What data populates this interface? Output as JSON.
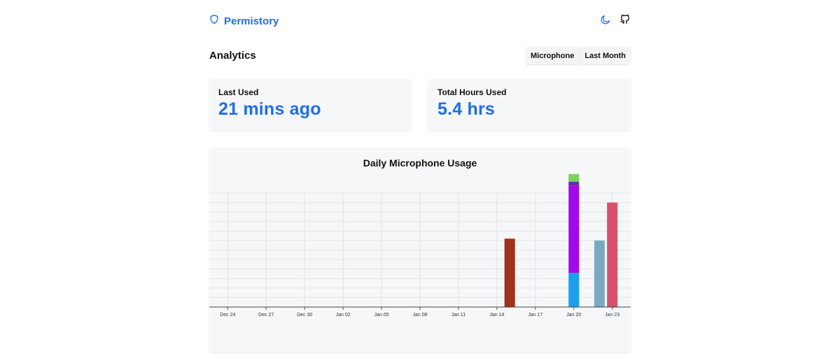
{
  "header": {
    "brand": "Permistory",
    "brand_icon": "shield-icon",
    "theme_icon": "moon-icon",
    "repo_icon": "github-icon",
    "accent": "#1f6fe5"
  },
  "analytics": {
    "title": "Analytics",
    "metric_button": "Microphone",
    "range_button": "Last Month"
  },
  "cards": {
    "last_used": {
      "label": "Last Used",
      "value": "21 mins ago"
    },
    "total_hours": {
      "label": "Total Hours Used",
      "value": "5.4 hrs"
    }
  },
  "chart_data": {
    "type": "bar",
    "stacked": true,
    "title": "Daily Microphone Usage",
    "xlabel": "",
    "ylabel": "",
    "grid": true,
    "x_tick_labels": [
      "Dec 24",
      "Dec 27",
      "Dec 30",
      "Jan 02",
      "Jan 05",
      "Jan 08",
      "Jan 11",
      "Jan 14",
      "Jan 17",
      "Jan 20",
      "Jan 23"
    ],
    "x_range": [
      "Dec 23",
      "Jan 24"
    ],
    "bars": [
      {
        "date": "Jan 15",
        "segments": [
          {
            "value": 1.8,
            "color": "#a0311b"
          }
        ]
      },
      {
        "date": "Jan 20",
        "segments": [
          {
            "value": 0.9,
            "color": "#1aa0ee"
          },
          {
            "value": 2.3,
            "color": "#a00ae8"
          },
          {
            "value": 0.1,
            "color": "#6a2ba8"
          },
          {
            "value": 0.2,
            "color": "#7ad35e"
          }
        ]
      },
      {
        "date": "Jan 22",
        "segments": [
          {
            "value": 1.75,
            "color": "#7aa9c3"
          }
        ]
      },
      {
        "date": "Jan 23",
        "segments": [
          {
            "value": 2.75,
            "color": "#d9506b"
          }
        ]
      }
    ],
    "ylim": [
      0,
      3.0
    ],
    "y_grid_step": 0.25
  }
}
